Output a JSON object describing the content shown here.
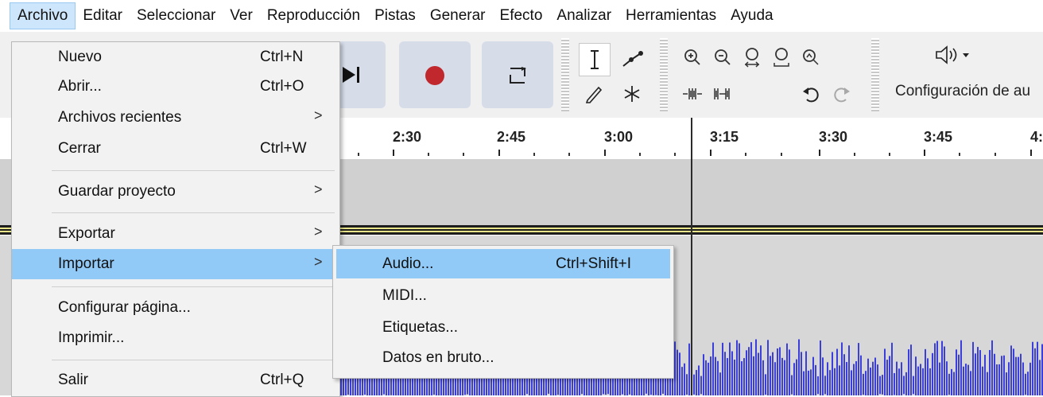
{
  "menubar": {
    "items": [
      "Archivo",
      "Editar",
      "Seleccionar",
      "Ver",
      "Reproducción",
      "Pistas",
      "Generar",
      "Efecto",
      "Analizar",
      "Herramientas",
      "Ayuda"
    ]
  },
  "toolbar": {
    "device_config_label": "Configuración de au"
  },
  "ruler": {
    "labels": [
      "2:30",
      "2:45",
      "3:00",
      "3:15",
      "3:30",
      "3:45",
      "4:"
    ]
  },
  "archivo_menu": {
    "items": [
      {
        "label": "Nuevo",
        "shortcut": "Ctrl+N"
      },
      {
        "label": "Abrir...",
        "shortcut": "Ctrl+O"
      },
      {
        "label": "Archivos recientes",
        "submenu": ">"
      },
      {
        "label": "Cerrar",
        "shortcut": "Ctrl+W"
      },
      {
        "label": "Guardar proyecto",
        "submenu": ">"
      },
      {
        "label": "Exportar",
        "submenu": ">"
      },
      {
        "label": "Importar",
        "submenu": ">"
      },
      {
        "label": "Configurar página..."
      },
      {
        "label": "Imprimir..."
      },
      {
        "label": "Salir",
        "shortcut": "Ctrl+Q"
      }
    ]
  },
  "importar_submenu": {
    "items": [
      {
        "label": "Audio...",
        "shortcut": "Ctrl+Shift+I"
      },
      {
        "label": "MIDI..."
      },
      {
        "label": "Etiquetas..."
      },
      {
        "label": "Datos en bruto..."
      }
    ]
  },
  "colors": {
    "highlight": "#91c9f7",
    "record": "#c0282d",
    "waveform": "#3b3fd8",
    "track_background": "#d7d7d7"
  }
}
